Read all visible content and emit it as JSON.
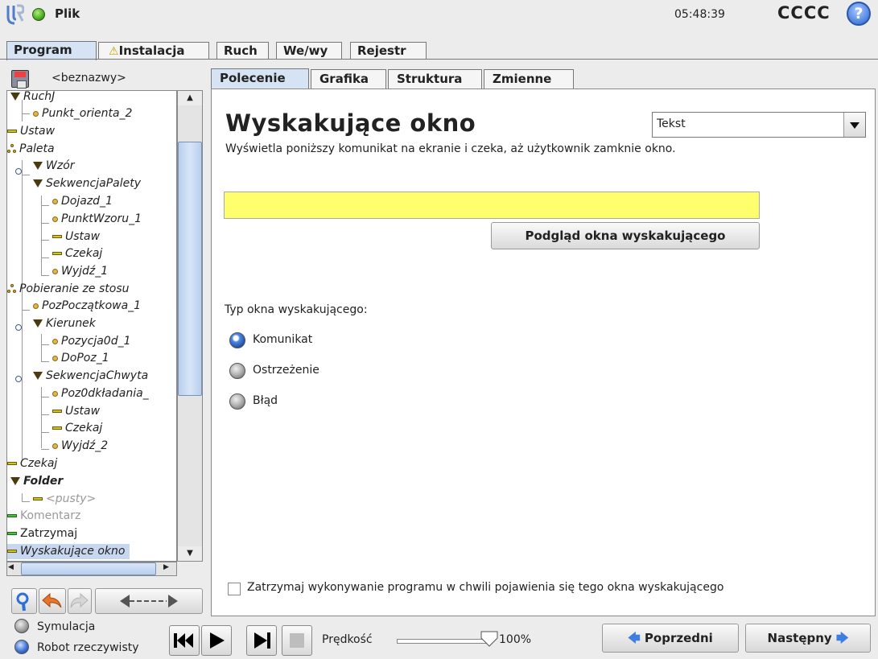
{
  "header": {
    "file_label": "Plik",
    "clock": "05:48:39",
    "robot_name": "CCCC",
    "help_symbol": "?"
  },
  "main_tabs": [
    {
      "label": "Program",
      "active": true
    },
    {
      "label": "Instalacja",
      "warning": true
    },
    {
      "label": "Ruch"
    },
    {
      "label": "We/wy"
    },
    {
      "label": "Rejestr"
    }
  ],
  "program_name": "<beznazwy>",
  "tree": {
    "items": [
      "RuchJ",
      "Punkt_orienta_2",
      "Ustaw",
      "Paleta",
      "Wzór",
      "SekwencjaPalety",
      "Dojazd_1",
      "PunktWzoru_1",
      "Ustaw",
      "Czekaj",
      "Wyjdź_1",
      "Pobieranie ze stosu",
      "PozPoczątkowa_1",
      "Kierunek",
      "Pozycja0d_1",
      "DoPoz_1",
      "SekwencjaChwyta",
      "Poz0dkładania_",
      "Ustaw",
      "Czekaj",
      "Wyjdź_2",
      "Czekaj",
      "Folder",
      "<pusty>",
      "Komentarz",
      "Zatrzymaj",
      "Wyskakujące okno"
    ],
    "selected": "Wyskakujące okno"
  },
  "sub_tabs": [
    {
      "label": "Polecenie",
      "active": true
    },
    {
      "label": "Grafika"
    },
    {
      "label": "Struktura"
    },
    {
      "label": "Zmienne"
    }
  ],
  "command": {
    "heading": "Wyskakujące okno",
    "description": "Wyświetla poniższy komunikat na ekranie i czeka, aż użytkownik zamknie okno.",
    "type_select_value": "Tekst",
    "message_value": "",
    "preview_button": "Podgląd okna wyskakującego",
    "type_label": "Typ okna wyskakującego:",
    "types": [
      {
        "label": "Komunikat",
        "selected": true
      },
      {
        "label": "Ostrzeżenie",
        "selected": false
      },
      {
        "label": "Błąd",
        "selected": false
      }
    ],
    "stop_checkbox_label": "Zatrzymaj wykonywanie programu w chwili pojawienia się tego okna wyskakującego",
    "stop_checked": false
  },
  "footer": {
    "mode_sim": "Symulacja",
    "mode_real": "Robot rzeczywisty",
    "speed_label": "Prędkość",
    "speed_value": "100%",
    "speed_fraction": 1.0,
    "prev_button": "Poprzedni",
    "next_button": "Następny"
  },
  "colors": {
    "accent": "#d6e3f4",
    "message_field": "#ffff6e",
    "selected_row": "#c7d7ef",
    "status_green": "#3e9b14",
    "arrow_blue": "#3d7ee0"
  }
}
